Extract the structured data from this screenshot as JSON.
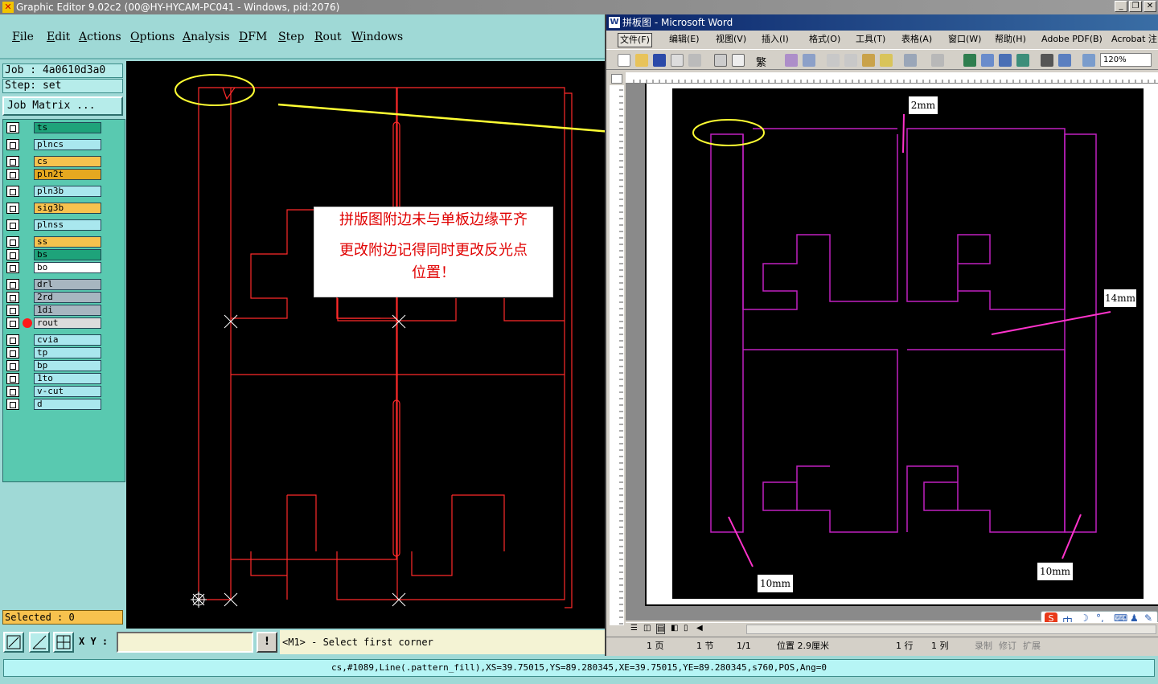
{
  "ge_window": {
    "title": "Graphic Editor 9.02c2 (00@HY-HYCAM-PC041 - Windows, pid:2076)",
    "menu": [
      "File",
      "Edit",
      "Actions",
      "Options",
      "Analysis",
      "DFM",
      "Step",
      "Rout",
      "Windows"
    ],
    "job_label": "Job : 4a0610d3a0",
    "step_label": "Step: set",
    "job_matrix_label": "Job Matrix ...",
    "selected_label": "Selected : 0",
    "layers": [
      {
        "name": "ts",
        "color": "#1ea37a"
      },
      {
        "name": "plncs",
        "color": "#a9e7ee"
      },
      {
        "name": "cs",
        "color": "#f7c24e"
      },
      {
        "name": "pln2t",
        "color": "#e5a820"
      },
      {
        "name": "pln3b",
        "color": "#a9e7ee"
      },
      {
        "name": "sig3b",
        "color": "#f7c24e"
      },
      {
        "name": "plnss",
        "color": "#a9e7ee"
      },
      {
        "name": "ss",
        "color": "#f7c24e"
      },
      {
        "name": "bs",
        "color": "#1ea37a"
      },
      {
        "name": "bo",
        "color": "#ffffff"
      },
      {
        "name": "drl",
        "color": "#a7b6c0"
      },
      {
        "name": "2rd",
        "color": "#a7b6c0"
      },
      {
        "name": "1di",
        "color": "#a7b6c0"
      },
      {
        "name": "rout",
        "color": "#dcdcdc"
      },
      {
        "name": "cvia",
        "color": "#a9e7ee"
      },
      {
        "name": "tp",
        "color": "#a9e7ee"
      },
      {
        "name": "bp",
        "color": "#a9e7ee"
      },
      {
        "name": "1to",
        "color": "#a9e7ee"
      },
      {
        "name": "v-cut",
        "color": "#a9e7ee"
      },
      {
        "name": "d",
        "color": "#a9e7ee"
      }
    ],
    "xy_label": "X Y :",
    "xy_value": "",
    "warning_glyph": "!",
    "prompt": "<M1> - Select first corner",
    "status_line": "cs,#1089,Line(.pattern_fill),XS=39.75015,YS=89.280345,XE=39.75015,YE=89.280345,s760,POS,Ang=0"
  },
  "callout": {
    "line1": "拼版图附边未与单板边缘平齐",
    "line2": "更改附边记得同时更改反光点",
    "line3": "位置！"
  },
  "word_window": {
    "title": "拼板图 - Microsoft Word",
    "menu": [
      "文件(F)",
      "编辑(E)",
      "视图(V)",
      "插入(I)",
      "格式(O)",
      "工具(T)",
      "表格(A)",
      "窗口(W)",
      "帮助(H)",
      "Adobe PDF(B)",
      "Acrobat 注"
    ],
    "font_style": "繁",
    "zoom": "120%",
    "labels": {
      "top": "2mm",
      "right": "14mm",
      "bottom_left": "10mm",
      "bottom_right": "10mm"
    },
    "status": {
      "page": "1 页",
      "section": "1 节",
      "pages": "1/1",
      "position": "位置 2.9厘米",
      "line": "1 行",
      "column": "1 列",
      "rec": "录制",
      "trk": "修订",
      "ext": "扩展"
    },
    "ime": "中"
  },
  "colors": {
    "rout_line": "#ff2a2a",
    "doc_line": "#c020c0",
    "annotation": "#ffff33"
  }
}
